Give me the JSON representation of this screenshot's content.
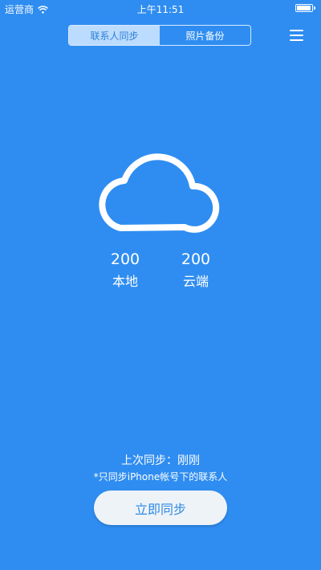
{
  "status_bar": {
    "carrier": "运营商",
    "time": "上午11:51",
    "wifi_icon": "wifi-icon",
    "battery_level": 0.95
  },
  "tabs": [
    {
      "label": "联系人同步",
      "active": true
    },
    {
      "label": "照片备份",
      "active": false
    }
  ],
  "menu_icon": "hamburger-menu-icon",
  "cloud_icon": "cloud-icon",
  "stats": {
    "local": {
      "value": "200",
      "label": "本地"
    },
    "cloud": {
      "value": "200",
      "label": "云端"
    }
  },
  "last_sync": "上次同步：刚刚",
  "note": "*只同步iPhone帐号下的联系人",
  "sync_button": "立即同步",
  "colors": {
    "background": "#2f8df1",
    "active_tab_bg": "#bcdcff",
    "button_bg": "#eef3f8",
    "button_text": "#2f8ae3"
  }
}
